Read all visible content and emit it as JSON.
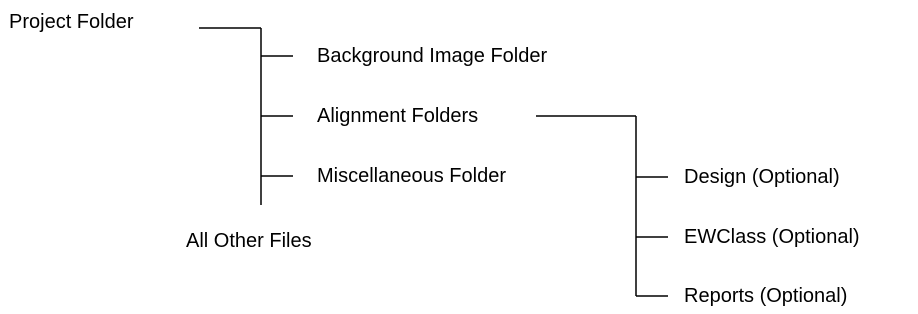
{
  "tree": {
    "root": "Project Folder",
    "children": [
      "Background Image Folder",
      "Alignment Folders",
      "Miscellaneous Folder"
    ],
    "root_files": "All Other Files",
    "alignment_children": [
      "Design (Optional)",
      "EWClass (Optional)",
      "Reports (Optional)"
    ]
  },
  "colors": {
    "line": "#000000",
    "text": "#000000",
    "background": "#ffffff"
  }
}
